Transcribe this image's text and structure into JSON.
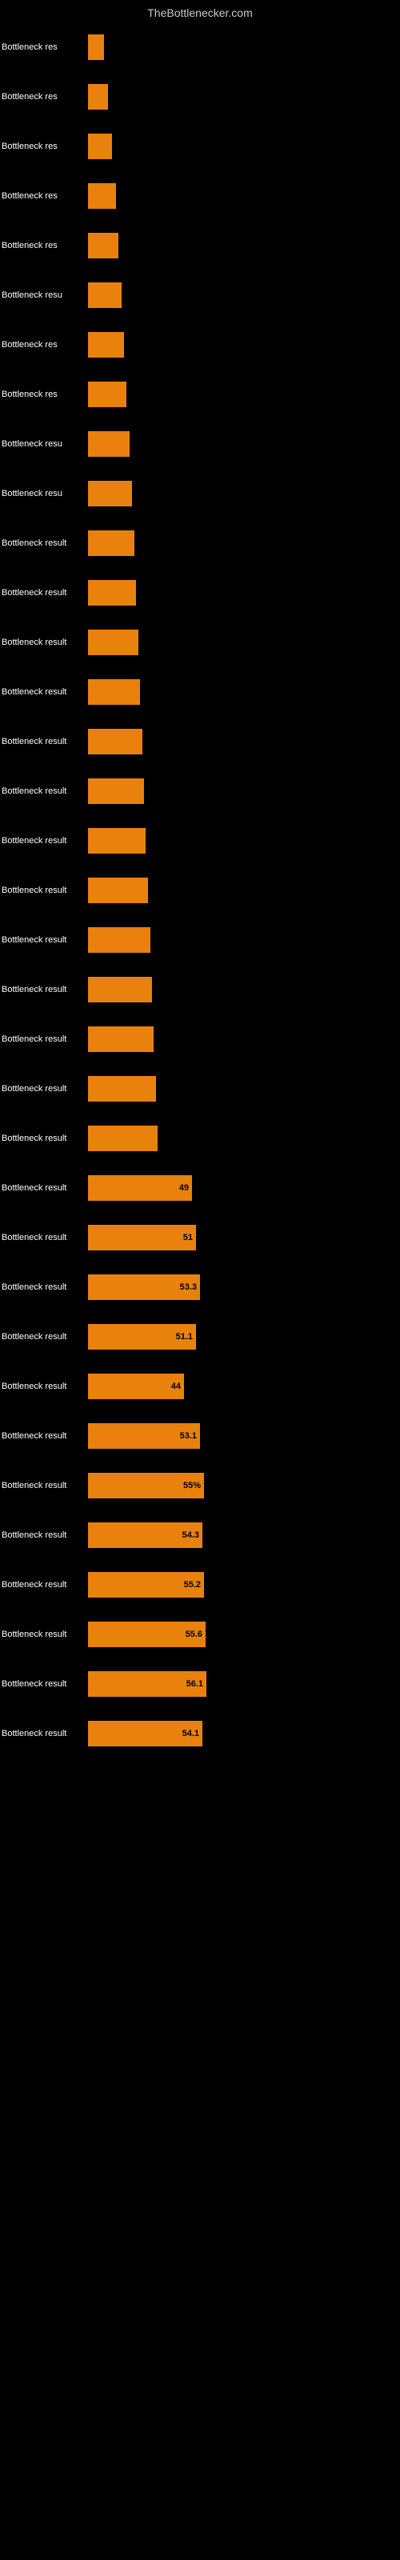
{
  "header": {
    "title": "TheBottlenecker.com"
  },
  "bars": [
    {
      "label": "Bottleneck res",
      "value": null,
      "width": 20
    },
    {
      "label": "Bottleneck res",
      "value": null,
      "width": 25
    },
    {
      "label": "Bottleneck res",
      "value": null,
      "width": 30
    },
    {
      "label": "Bottleneck res",
      "value": null,
      "width": 35
    },
    {
      "label": "Bottleneck res",
      "value": null,
      "width": 38
    },
    {
      "label": "Bottleneck resu",
      "value": null,
      "width": 42
    },
    {
      "label": "Bottleneck res",
      "value": null,
      "width": 45
    },
    {
      "label": "Bottleneck res",
      "value": null,
      "width": 48
    },
    {
      "label": "Bottleneck resu",
      "value": null,
      "width": 52
    },
    {
      "label": "Bottleneck resu",
      "value": null,
      "width": 55
    },
    {
      "label": "Bottleneck result",
      "value": null,
      "width": 58
    },
    {
      "label": "Bottleneck result",
      "value": null,
      "width": 60
    },
    {
      "label": "Bottleneck result",
      "value": null,
      "width": 63
    },
    {
      "label": "Bottleneck result",
      "value": null,
      "width": 65
    },
    {
      "label": "Bottleneck result",
      "value": null,
      "width": 68
    },
    {
      "label": "Bottleneck result",
      "value": null,
      "width": 70
    },
    {
      "label": "Bottleneck result",
      "value": null,
      "width": 72
    },
    {
      "label": "Bottleneck result",
      "value": null,
      "width": 75
    },
    {
      "label": "Bottleneck result",
      "value": null,
      "width": 78
    },
    {
      "label": "Bottleneck result",
      "value": null,
      "width": 80
    },
    {
      "label": "Bottleneck result",
      "value": null,
      "width": 82
    },
    {
      "label": "Bottleneck result",
      "value": null,
      "width": 85
    },
    {
      "label": "Bottleneck result",
      "value": null,
      "width": 87
    },
    {
      "label": "Bottleneck result",
      "value": "49",
      "width": 130
    },
    {
      "label": "Bottleneck result",
      "value": "51",
      "width": 135
    },
    {
      "label": "Bottleneck result",
      "value": "53.3",
      "width": 140
    },
    {
      "label": "Bottleneck result",
      "value": "51.1",
      "width": 135
    },
    {
      "label": "Bottleneck result",
      "value": "44",
      "width": 120
    },
    {
      "label": "Bottleneck result",
      "value": "53.1",
      "width": 140
    },
    {
      "label": "Bottleneck result",
      "value": "55%",
      "width": 145
    },
    {
      "label": "Bottleneck result",
      "value": "54.3",
      "width": 143
    },
    {
      "label": "Bottleneck result",
      "value": "55.2",
      "width": 145
    },
    {
      "label": "Bottleneck result",
      "value": "55.6",
      "width": 147
    },
    {
      "label": "Bottleneck result",
      "value": "56.1",
      "width": 148
    },
    {
      "label": "Bottleneck result",
      "value": "54.1",
      "width": 143
    }
  ]
}
